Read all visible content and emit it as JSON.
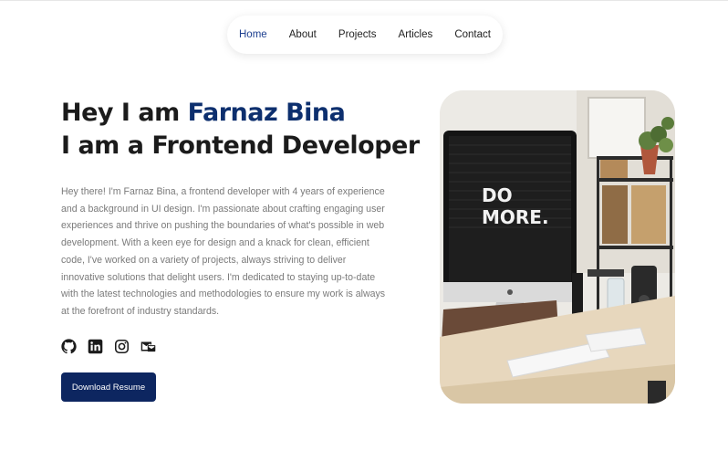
{
  "nav": {
    "items": [
      {
        "label": "Home",
        "active": true
      },
      {
        "label": "About",
        "active": false
      },
      {
        "label": "Projects",
        "active": false
      },
      {
        "label": "Articles",
        "active": false
      },
      {
        "label": "Contact",
        "active": false
      }
    ]
  },
  "hero": {
    "greeting_prefix": "Hey I am ",
    "name": "Farnaz Bina",
    "role_line": "I am a Frontend Developer",
    "bio": "Hey there! I'm Farnaz Bina, a frontend developer with 4 years of experience and a background in UI design. I'm passionate about crafting engaging user experiences and thrive on pushing the boundaries of what's possible in web development. With a keen eye for design and a knack for clean, efficient code, I've worked on a variety of projects, always striving to deliver innovative solutions that delight users. I'm dedicated to staying up-to-date with the latest technologies and methodologies to ensure my work is always at the forefront of industry standards.",
    "download_label": "Download Resume"
  },
  "socials": [
    "github-icon",
    "linkedin-icon",
    "instagram-icon",
    "email-icon"
  ],
  "photo": {
    "screen_text_line1": "DO",
    "screen_text_line2": "MORE."
  },
  "colors": {
    "accent": "#0d2f6e",
    "button": "#0d2660",
    "nav_active": "#1d3f8f",
    "text_muted": "#7a7a7a"
  }
}
